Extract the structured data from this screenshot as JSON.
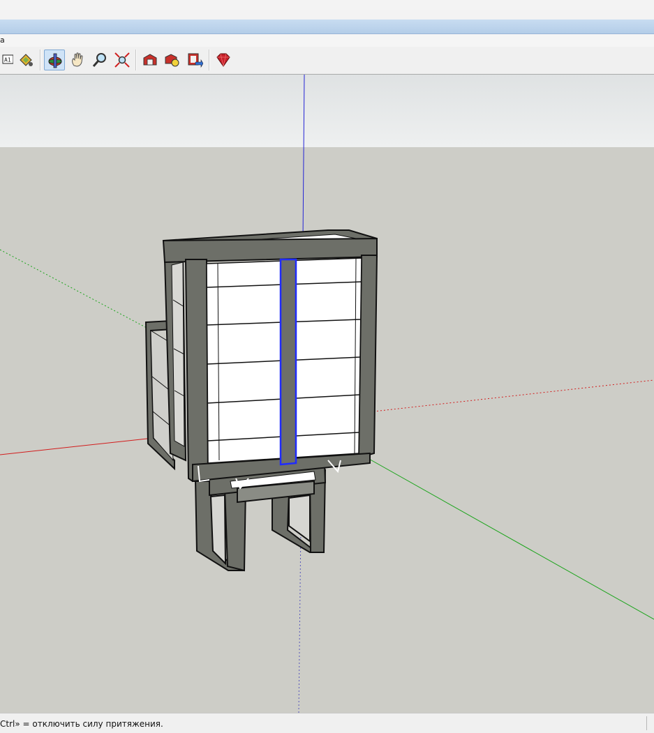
{
  "menu": {
    "partial_item": "а"
  },
  "toolbar": {
    "tools": [
      {
        "id": "dimension",
        "icon": "dimension-icon",
        "label": "A1"
      },
      {
        "id": "paint",
        "icon": "paint-bucket-icon"
      },
      {
        "id": "orbit",
        "icon": "orbit-icon",
        "active": true
      },
      {
        "id": "pan",
        "icon": "pan-hand-icon"
      },
      {
        "id": "zoom",
        "icon": "zoom-icon"
      },
      {
        "id": "zoom-extents",
        "icon": "zoom-extents-icon"
      },
      {
        "id": "warehouse",
        "icon": "3d-warehouse-icon"
      },
      {
        "id": "components",
        "icon": "share-component-icon"
      },
      {
        "id": "extensions",
        "icon": "extension-warehouse-icon"
      },
      {
        "id": "ruby",
        "icon": "ruby-console-icon"
      }
    ]
  },
  "colors": {
    "sky": "#e6e9ea",
    "ground": "#cdcdc7",
    "frame": "#6d6f68",
    "panel": "#ffffff",
    "selection": "#1f2bff",
    "axis_red": "#d21c1c",
    "axis_green": "#1aa41a",
    "axis_blue": "#2424d6"
  },
  "status": {
    "hint": "Ctrl» = отключить силу притяжения."
  }
}
